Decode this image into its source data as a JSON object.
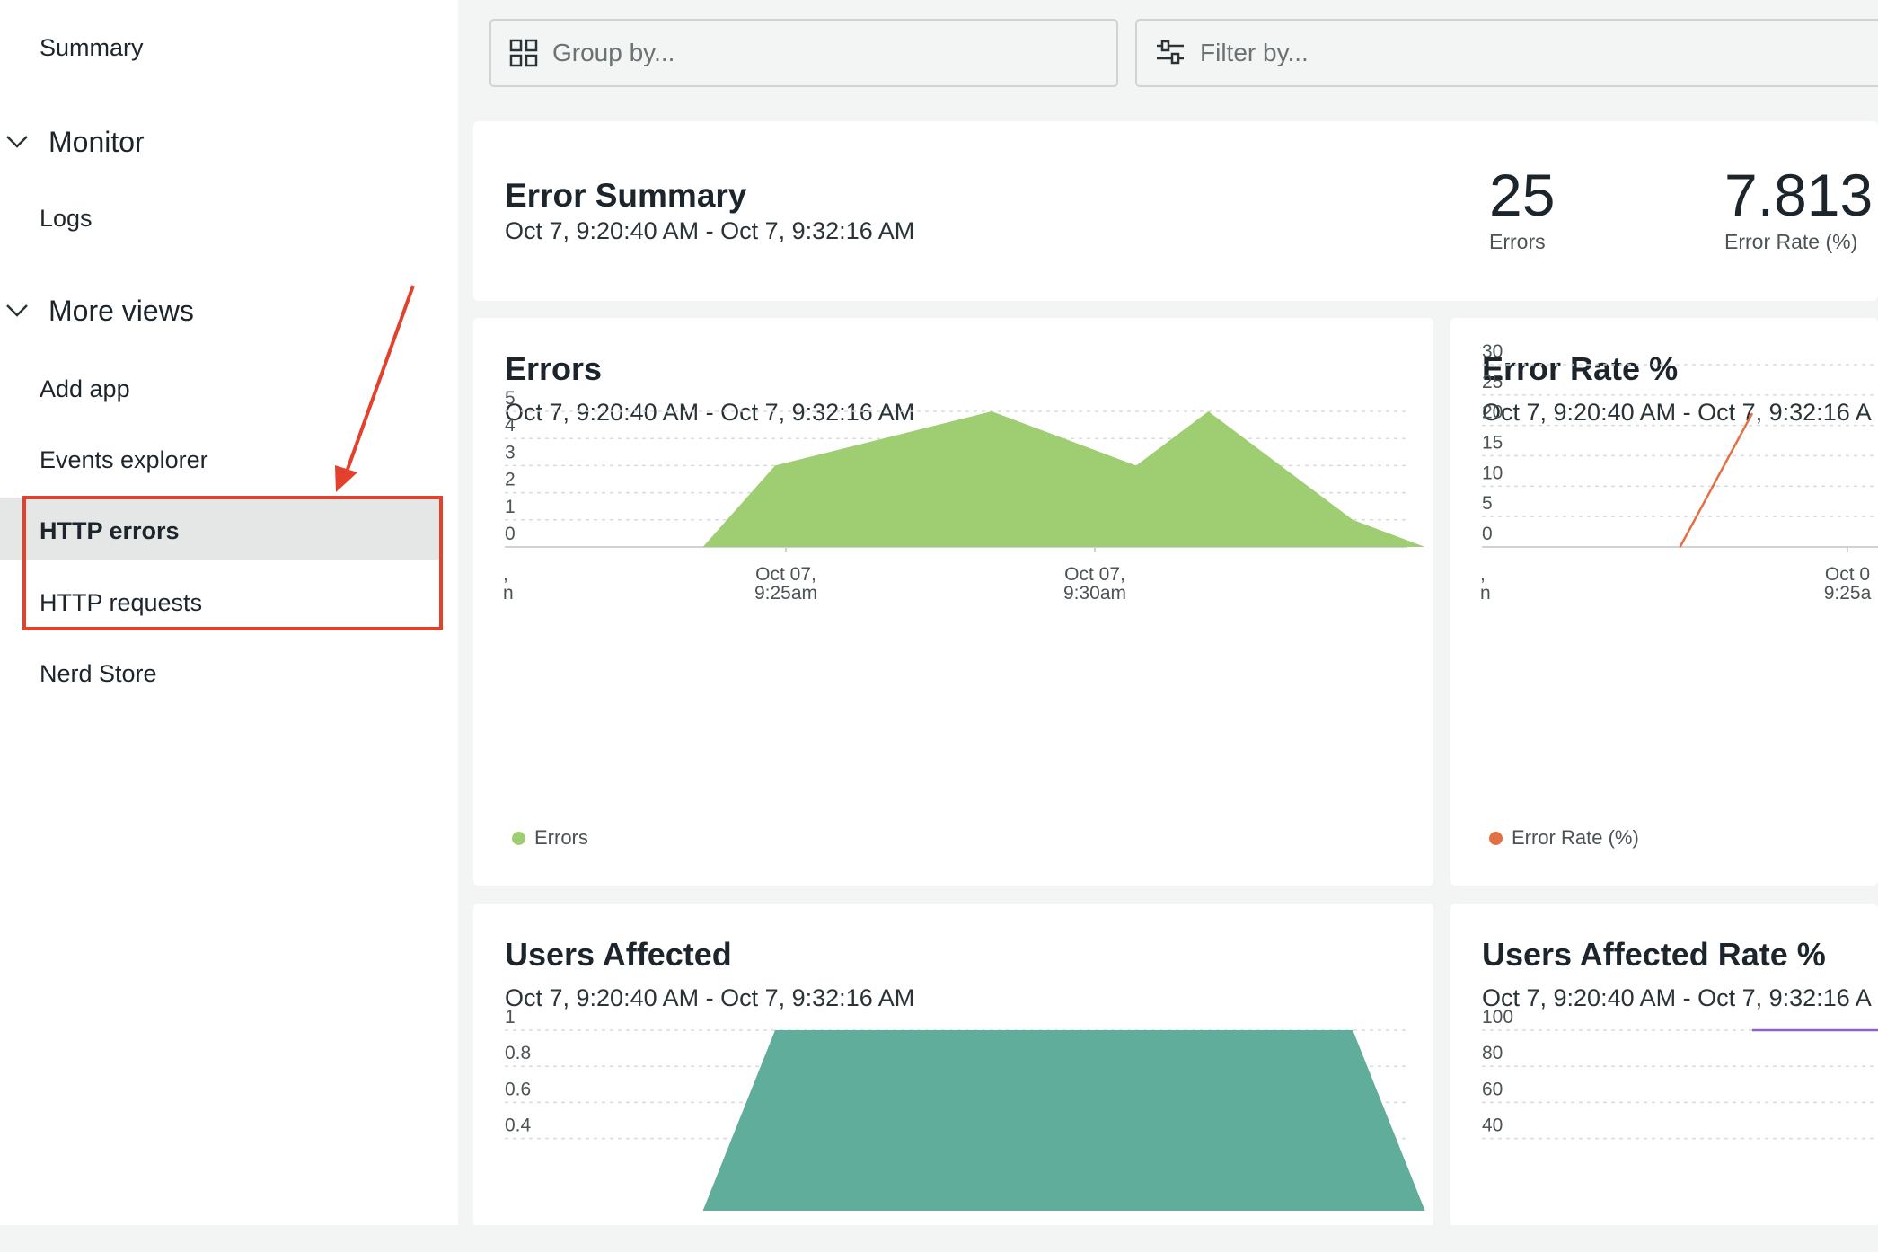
{
  "sidebar": {
    "summary": "Summary",
    "monitor": {
      "label": "Monitor",
      "items": [
        "Logs"
      ]
    },
    "more_views": {
      "label": "More views",
      "items": [
        "Add app",
        "Events explorer",
        "HTTP errors",
        "HTTP requests"
      ]
    },
    "nerd_store": "Nerd Store"
  },
  "toolbar": {
    "group_placeholder": "Group by...",
    "filter_placeholder": "Filter by..."
  },
  "error_summary": {
    "title": "Error Summary",
    "range": "Oct 7, 9:20:40 AM - Oct 7, 9:32:16 AM",
    "errors_value": "25",
    "errors_label": "Errors",
    "rate_value": "7.813",
    "rate_label": "Error Rate (%)"
  },
  "colors": {
    "errors_area": "#9fcd72",
    "error_rate_line": "#e46f45",
    "users_area": "#61ad9c",
    "users_rate_line": "#8e63c4",
    "annotation": "#e2412c"
  },
  "cards": {
    "errors": {
      "title": "Errors",
      "range": "Oct 7, 9:20:40 AM - Oct 7, 9:32:16 AM",
      "legend": "Errors"
    },
    "error_rate": {
      "title": "Error Rate %",
      "range": "Oct 7, 9:20:40 AM - Oct 7, 9:32:16 A",
      "legend": "Error Rate (%)"
    },
    "users": {
      "title": "Users Affected",
      "range": "Oct 7, 9:20:40 AM - Oct 7, 9:32:16 AM"
    },
    "users_rate": {
      "title": "Users Affected Rate %",
      "range": "Oct 7, 9:20:40 AM - Oct 7, 9:32:16 A"
    }
  },
  "chart_data": [
    {
      "type": "area",
      "title": "Errors",
      "x_tick_labels": [
        [
          "Oct 07,",
          "9:25am"
        ],
        [
          "Oct 07,",
          "9:30am"
        ]
      ],
      "y_ticks": [
        "5",
        "4",
        "3",
        "2",
        "1",
        "0"
      ],
      "ylim": [
        0,
        5
      ],
      "series": [
        {
          "name": "Errors",
          "x": [
            "9:22am",
            "9:23am",
            "9:26am",
            "9:28am",
            "9:29am",
            "9:31am",
            "9:32am"
          ],
          "values": [
            0,
            3,
            5,
            3,
            5,
            1,
            0
          ]
        }
      ]
    },
    {
      "type": "line",
      "title": "Error Rate %",
      "x_tick_labels": [
        [
          "Oct 0",
          "9:25a"
        ]
      ],
      "y_ticks": [
        "30",
        "25",
        "20",
        "15",
        "10",
        "5",
        "0"
      ],
      "ylim": [
        0,
        30
      ],
      "series": [
        {
          "name": "Error Rate (%)",
          "x": [
            "9:22am",
            "9:23am"
          ],
          "values": [
            0,
            22
          ]
        }
      ]
    },
    {
      "type": "area",
      "title": "Users Affected",
      "y_ticks": [
        "1",
        "0.8",
        "0.6",
        "0.4"
      ],
      "ylim": [
        0,
        1
      ],
      "series": [
        {
          "x": [
            "9:22am",
            "9:23am",
            "9:31am",
            "9:32am"
          ],
          "values": [
            0,
            1,
            1,
            0
          ]
        }
      ]
    },
    {
      "type": "line",
      "title": "Users Affected Rate %",
      "y_ticks": [
        "100",
        "80",
        "60",
        "40"
      ],
      "ylim": [
        0,
        100
      ],
      "series": [
        {
          "x": [
            "9:23am",
            "9:25am"
          ],
          "values": [
            100,
            100
          ]
        }
      ]
    }
  ]
}
